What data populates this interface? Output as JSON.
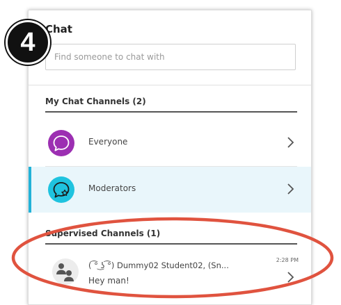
{
  "step_badge": "4",
  "chat": {
    "title": "Chat",
    "search_placeholder": "Find someone to chat with"
  },
  "my_channels": {
    "heading": "My Chat Channels (2)",
    "items": [
      {
        "label": "Everyone",
        "icon": "chat-bubble-icon",
        "color": "#9c2fb2",
        "active": false
      },
      {
        "label": "Moderators",
        "icon": "moderator-chat-icon",
        "color": "#1fc3df",
        "active": true
      }
    ]
  },
  "supervised_channels": {
    "heading": "Supervised Channels (1)",
    "items": [
      {
        "name": "( ͡° ͜ʖ ͡°) Dummy02 Student02,  (Sn...",
        "message": "Hey man!",
        "time": "2:28 PM",
        "icon": "group-users-icon"
      }
    ]
  },
  "colors": {
    "accent": "#22b2d8",
    "highlight_ellipse": "#e0533f",
    "active_row_bg": "#e9f6fb"
  }
}
